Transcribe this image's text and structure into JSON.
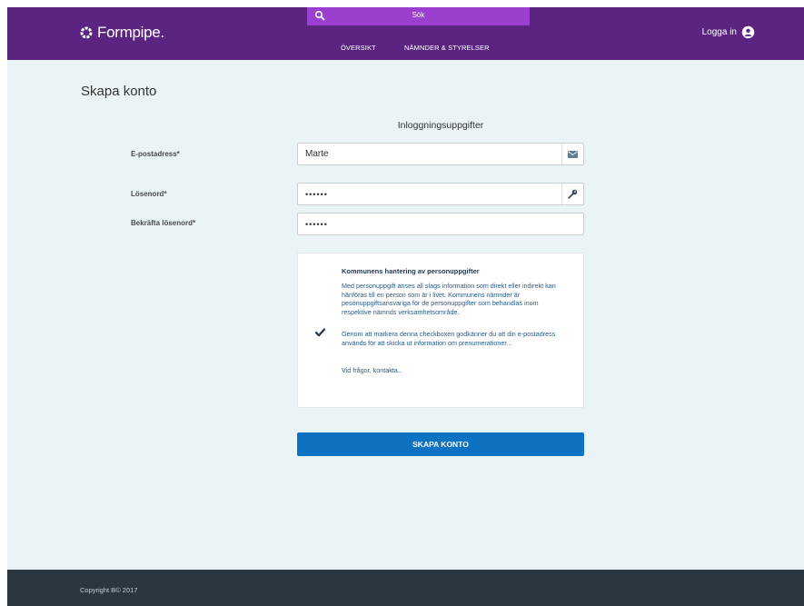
{
  "header": {
    "logo_text": "Formpipe.",
    "search_label": "Sök",
    "nav": [
      "ÖVERSIKT",
      "NÄMNDER & STYRELSER"
    ],
    "login_label": "Logga in",
    "colors": {
      "header_bg": "#5b2480",
      "search_bg": "#9a3fd0"
    }
  },
  "page": {
    "title": "Skapa konto",
    "section_title": "Inloggningsuppgifter"
  },
  "form": {
    "email_label": "E-postadress*",
    "email_value": "Marte",
    "email_icon": "envelope-icon",
    "password_label": "Lösenord*",
    "password_value": "••••••",
    "password_icon": "key-icon",
    "confirm_label": "Bekräfta lösenord*",
    "confirm_value": "••••••"
  },
  "consent": {
    "heading": "Kommunens hantering av personuppgifter",
    "paragraph1": "Med personuppgift anses all slags information som direkt eller indirekt kan hänföras till en person som är i livet. Kommunens nämnder är pesonuppgiftsansvariga för de personuppgifter som behandlas inom respektive nämnds verksamhetsområde.",
    "paragraph2": "Genom att markera denna checkboxen godkänner du att din e-postadress används för att skicka ut information om prenumerationer...",
    "link": "Vid frågor, kontakta..",
    "checked": true
  },
  "submit_label": "SKAPA KONTO",
  "footer": {
    "copyright": "Copyright B© 2017"
  },
  "colors": {
    "accent": "#0e72c3",
    "footer_bg": "#2a3741",
    "page_bg": "#eaf4f7"
  }
}
